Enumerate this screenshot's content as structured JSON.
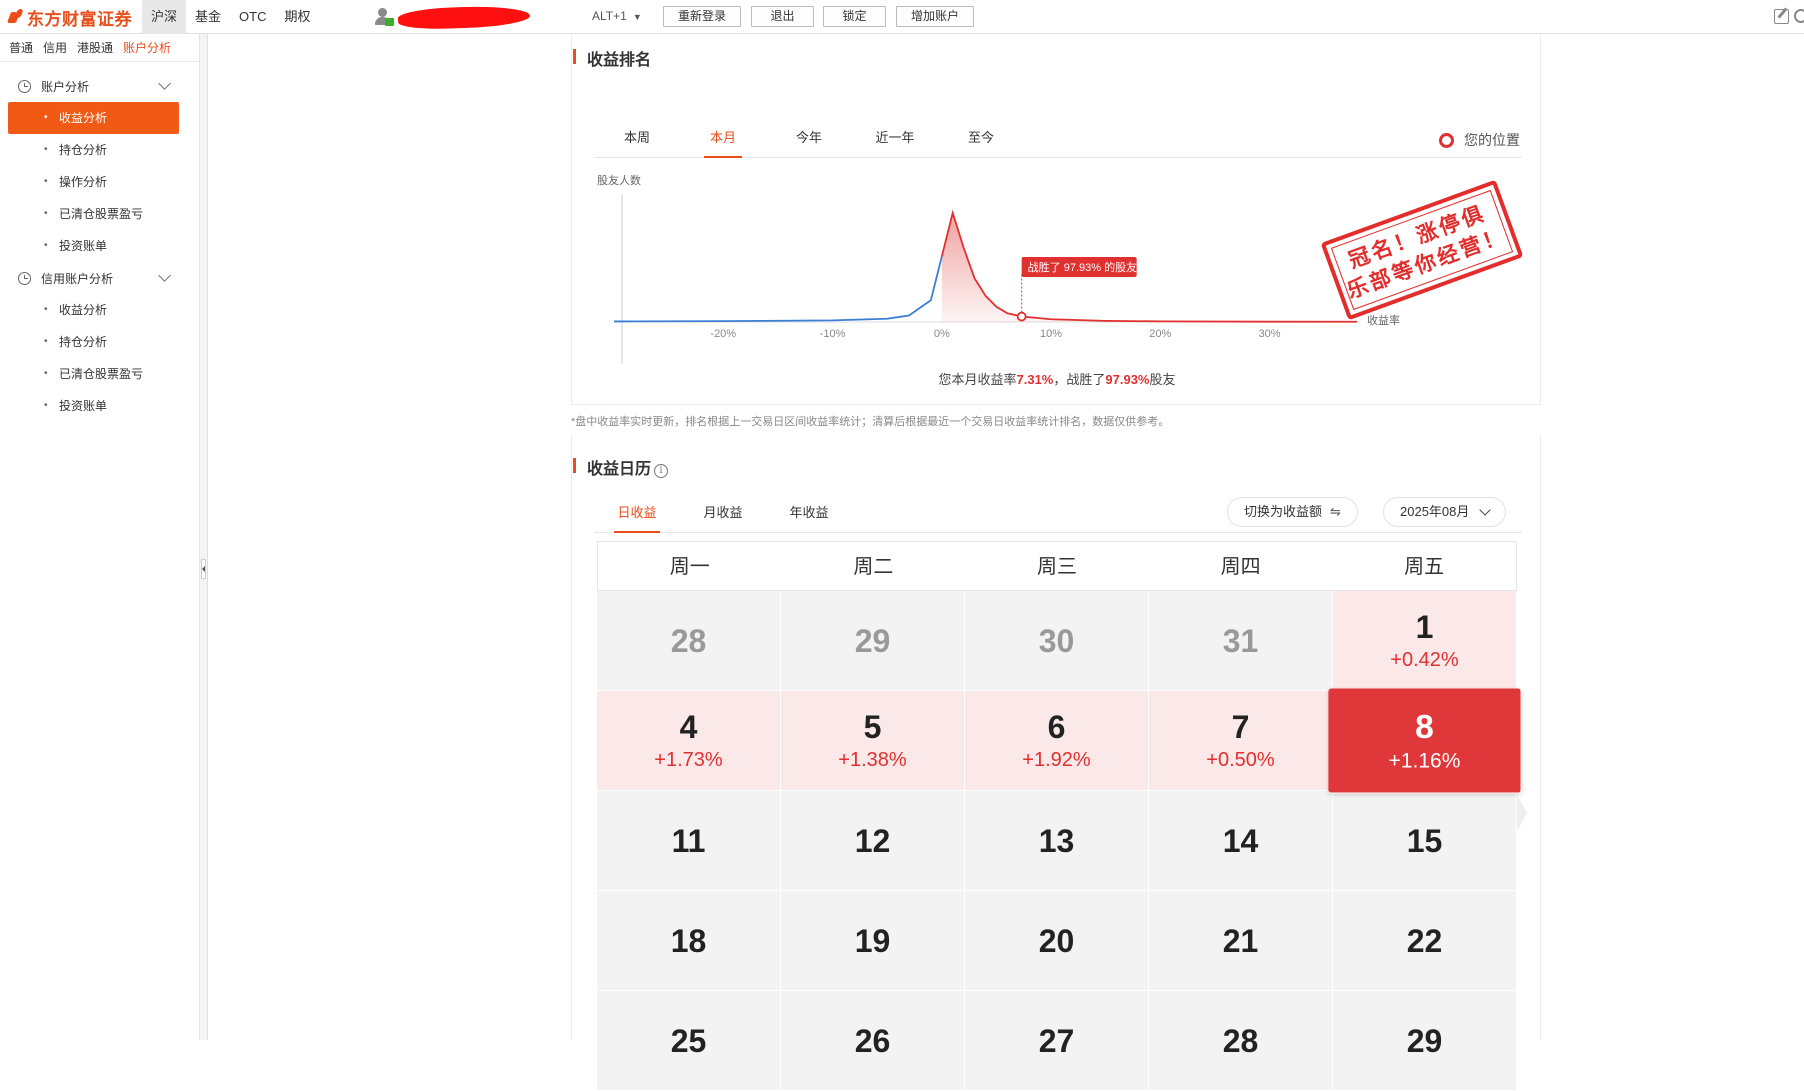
{
  "app": {
    "brand": "东方财富证券"
  },
  "market_tabs": [
    "沪深",
    "基金",
    "OTC",
    "期权"
  ],
  "topbar": {
    "alt_label": "ALT+1",
    "buttons": [
      "重新登录",
      "退出",
      "锁定",
      "增加账户"
    ]
  },
  "account_tabs": [
    "普通",
    "信用",
    "港股通",
    "账户分析"
  ],
  "sidebar": {
    "group1": {
      "label": "账户分析",
      "items": [
        "收益分析",
        "持仓分析",
        "操作分析",
        "已清仓股票盈亏",
        "投资账单"
      ]
    },
    "group2": {
      "label": "信用账户分析",
      "items": [
        "收益分析",
        "持仓分析",
        "已清仓股票盈亏",
        "投资账单"
      ]
    }
  },
  "ranking": {
    "title": "收益排名",
    "tabs": [
      "本周",
      "本月",
      "今年",
      "近一年",
      "至今"
    ],
    "legend": "您的位置",
    "stamp_lines": [
      "冠名！涨停俱",
      "乐部等你经营！"
    ],
    "summary_prefix": "您本月收益率",
    "summary_rate": "7.31%",
    "summary_mid": "，战胜了",
    "summary_pct": "97.93%",
    "summary_suffix": "股友"
  },
  "chart_data": {
    "type": "area",
    "ylabel": "股友人数",
    "xlabel": "收益率",
    "x_ticks": [
      "-20%",
      "-10%",
      "0%",
      "10%",
      "20%",
      "30%"
    ],
    "x_tick_values": [
      -20,
      -10,
      0,
      10,
      20,
      30
    ],
    "xlim": [
      -30,
      38
    ],
    "curve_x": [
      -30,
      -20,
      -10,
      -5,
      -3,
      -1,
      0,
      1,
      2,
      3,
      4,
      5,
      6,
      7.31,
      10,
      15,
      20,
      30,
      38
    ],
    "curve_y": [
      0.5,
      0.8,
      1.5,
      3,
      6,
      20,
      60,
      100,
      68,
      40,
      24,
      14,
      8,
      5,
      2.5,
      1,
      0.6,
      0.3,
      0.2
    ],
    "ylim": [
      0,
      110
    ],
    "marker_x": 7.31,
    "marker_label": "战胜了 97.93% 的股友",
    "colors": {
      "negative": "#3a7fd5",
      "positive": "#e0302f"
    }
  },
  "disclaimer": "*盘中收益率实时更新，排名根据上一交易日区间收益率统计；清算后根据最近一个交易日收益率统计排名，数据仅供参考。",
  "calendar": {
    "title": "收益日历",
    "info_glyph": "i",
    "tabs": [
      "日收益",
      "月收益",
      "年收益"
    ],
    "switch_label": "切换为收益额",
    "switch_glyph": "⇋",
    "month_label": "2025年08月",
    "weekdays": [
      "周一",
      "周二",
      "周三",
      "周四",
      "周五"
    ],
    "days": [
      {
        "d": "28",
        "v": "",
        "kind": "other"
      },
      {
        "d": "29",
        "v": "",
        "kind": "other"
      },
      {
        "d": "30",
        "v": "",
        "kind": "other"
      },
      {
        "d": "31",
        "v": "",
        "kind": "other"
      },
      {
        "d": "1",
        "v": "+0.42%",
        "kind": "pos"
      },
      {
        "d": "4",
        "v": "+1.73%",
        "kind": "pos"
      },
      {
        "d": "5",
        "v": "+1.38%",
        "kind": "pos"
      },
      {
        "d": "6",
        "v": "+1.92%",
        "kind": "pos"
      },
      {
        "d": "7",
        "v": "+0.50%",
        "kind": "pos"
      },
      {
        "d": "8",
        "v": "+1.16%",
        "kind": "sel"
      },
      {
        "d": "11",
        "v": "",
        "kind": "none"
      },
      {
        "d": "12",
        "v": "",
        "kind": "none"
      },
      {
        "d": "13",
        "v": "",
        "kind": "none"
      },
      {
        "d": "14",
        "v": "",
        "kind": "none"
      },
      {
        "d": "15",
        "v": "",
        "kind": "none"
      },
      {
        "d": "18",
        "v": "",
        "kind": "none"
      },
      {
        "d": "19",
        "v": "",
        "kind": "none"
      },
      {
        "d": "20",
        "v": "",
        "kind": "none"
      },
      {
        "d": "21",
        "v": "",
        "kind": "none"
      },
      {
        "d": "22",
        "v": "",
        "kind": "none"
      },
      {
        "d": "25",
        "v": "",
        "kind": "none"
      },
      {
        "d": "26",
        "v": "",
        "kind": "none"
      },
      {
        "d": "27",
        "v": "",
        "kind": "none"
      },
      {
        "d": "28",
        "v": "",
        "kind": "none"
      },
      {
        "d": "29",
        "v": "",
        "kind": "none"
      }
    ]
  }
}
